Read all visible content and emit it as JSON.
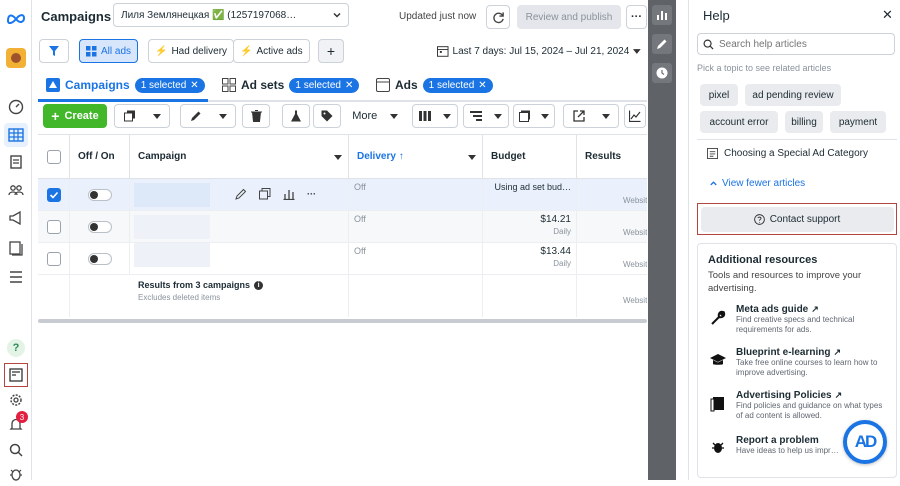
{
  "header": {
    "title": "Campaigns",
    "account": "Лиля Землянецкая ✅ (1257197068…",
    "updated": "Updated just now",
    "review_publish": "Review and publish",
    "more": "···"
  },
  "filters": {
    "all_ads": "All ads",
    "had_delivery": "Had delivery",
    "active_ads": "Active ads",
    "add": "+",
    "date_range": "Last 7 days: Jul 15, 2024 – Jul 21, 2024"
  },
  "tabs": [
    {
      "label": "Campaigns",
      "selected": "1 selected"
    },
    {
      "label": "Ad sets",
      "selected": "1 selected"
    },
    {
      "label": "Ads",
      "selected": "1 selected"
    }
  ],
  "toolbar": {
    "create": "Create",
    "more": "More"
  },
  "table": {
    "headers": {
      "off_on": "Off / On",
      "campaign": "Campaign",
      "delivery": "Delivery ↑",
      "budget": "Budget",
      "results": "Results"
    },
    "rows": [
      {
        "delivery": "Off",
        "budget": "Using ad set bud…",
        "budget_sub": "",
        "results_sub": "Websit",
        "checked": true
      },
      {
        "delivery": "Off",
        "budget": "$14.21",
        "budget_sub": "Daily",
        "results_sub": "Websit",
        "checked": false
      },
      {
        "delivery": "Off",
        "budget": "$13.44",
        "budget_sub": "Daily",
        "results_sub": "Websit",
        "checked": false
      }
    ],
    "summary": {
      "title": "Results from 3 campaigns",
      "sub": "Excludes deleted items",
      "results_sub": "Websit"
    }
  },
  "rail": {
    "notification_count": "3"
  },
  "help": {
    "title": "Help",
    "close": "✕",
    "search_placeholder": "Search help articles",
    "topic_hint": "Pick a topic to see related articles",
    "topics": [
      "pixel",
      "ad pending review",
      "account error",
      "billing",
      "payment"
    ],
    "article": "Choosing a Special Ad Category",
    "view_fewer": "View fewer articles",
    "contact_support": "Contact support",
    "additional_title": "Additional resources",
    "additional_sub": "Tools and resources to improve your advertising.",
    "resources": [
      {
        "title": "Meta ads guide",
        "desc": "Find creative specs and technical requirements for ads.",
        "external": true
      },
      {
        "title": "Blueprint e-learning",
        "desc": "Take free online courses to learn how to improve advertising.",
        "external": true
      },
      {
        "title": "Advertising Policies",
        "desc": "Find policies and guidance on what types of ad content is allowed.",
        "external": true
      },
      {
        "title": "Report a problem",
        "desc": "Have ideas to help us impr…",
        "external": false
      }
    ],
    "badge_text": "AD"
  },
  "colors": {
    "accent": "#1b74e4",
    "create_green": "#42b72a",
    "strip": "#5f6368",
    "alert": "#e41e3f"
  }
}
